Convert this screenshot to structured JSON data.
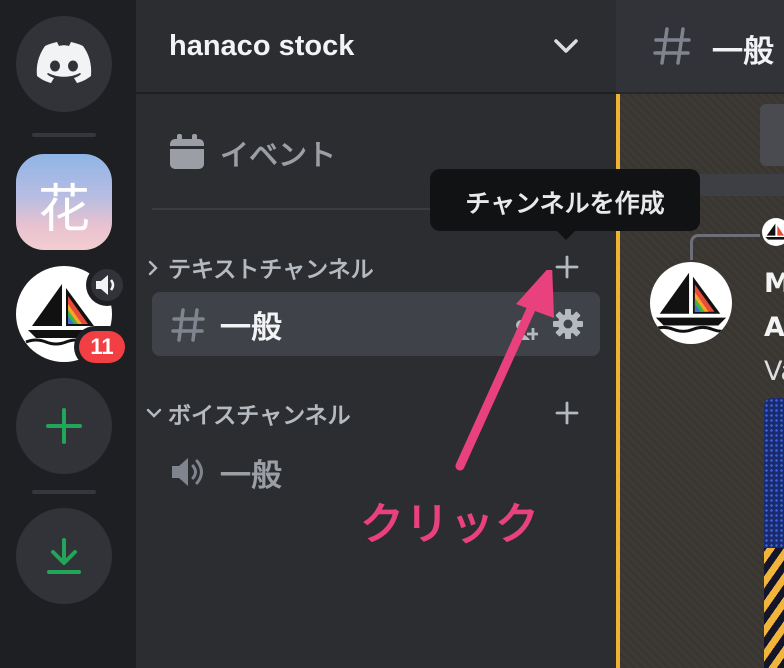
{
  "server": {
    "name": "hanaco stock",
    "events_label": "イベント"
  },
  "server_rail": {
    "hanaco_icon_text": "花",
    "midjourney_mentions": "11"
  },
  "categories": {
    "text": "テキストチャンネル",
    "voice": "ボイスチャンネル"
  },
  "channels": {
    "text_general": "一般",
    "voice_general": "一般"
  },
  "tooltip": "チャンネルを作成",
  "annotation": {
    "click_label": "クリック",
    "color": "#e8417e"
  },
  "main": {
    "channel_title": "一般",
    "message_line1": "M",
    "message_line2": "A",
    "message_line3": "Va"
  },
  "colors": {
    "accent_green": "#23a559",
    "mention_red": "#f23f43",
    "pending_border": "#f0b232"
  }
}
